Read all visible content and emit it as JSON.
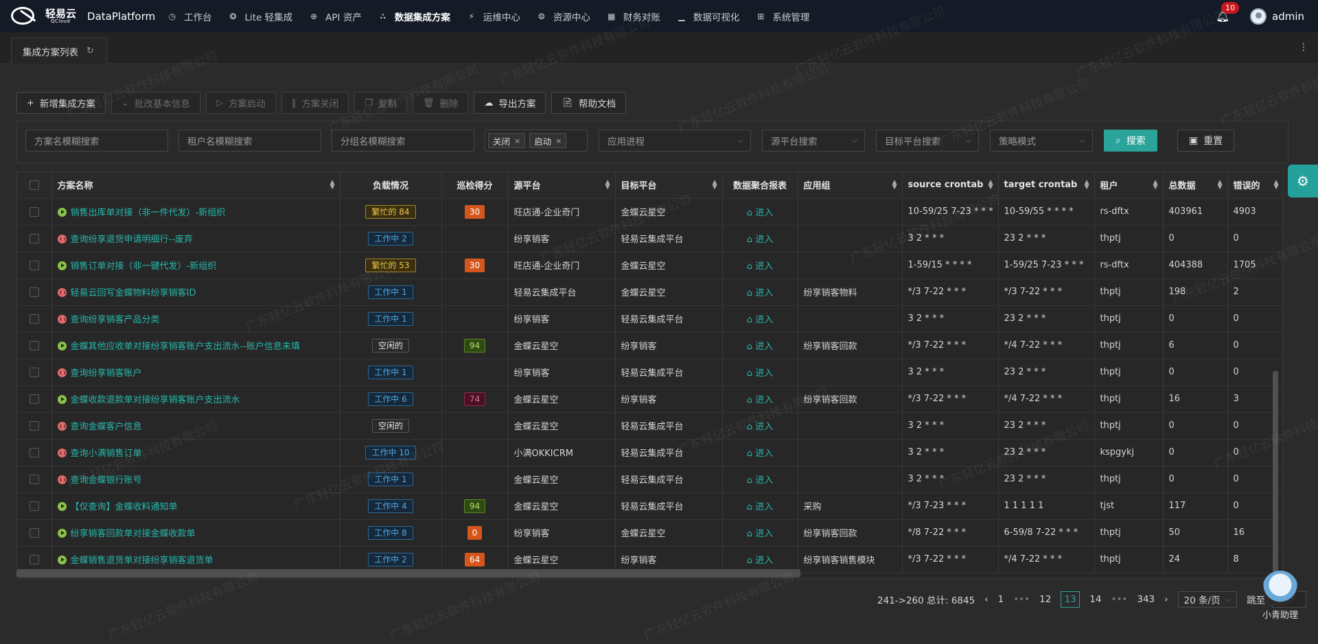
{
  "app": {
    "brand_cn": "轻易云",
    "brand_en": "QCloud",
    "title": "DataPlatform"
  },
  "nav": [
    {
      "label": "工作台",
      "icon": "clock-icon",
      "active": false
    },
    {
      "label": "Lite 轻集成",
      "icon": "bulb-icon",
      "active": false
    },
    {
      "label": "API 资产",
      "icon": "compass-icon",
      "active": false
    },
    {
      "label": "数据集成方案",
      "icon": "cluster-icon",
      "active": true
    },
    {
      "label": "运维中心",
      "icon": "bolt-icon",
      "active": false
    },
    {
      "label": "资源中心",
      "icon": "network-icon",
      "active": false
    },
    {
      "label": "财务对账",
      "icon": "calculator-icon",
      "active": false
    },
    {
      "label": "数据可视化",
      "icon": "chart-icon",
      "active": false
    },
    {
      "label": "系统管理",
      "icon": "apps-icon",
      "active": false
    }
  ],
  "notifications": {
    "count": "10"
  },
  "user": {
    "name": "admin"
  },
  "tab": {
    "label": "集成方案列表"
  },
  "toolbar": {
    "add": "新增集成方案",
    "batch_edit": "批改基本信息",
    "start": "方案启动",
    "close": "方案关闭",
    "copy": "复制",
    "delete": "删除",
    "export": "导出方案",
    "help": "帮助文档"
  },
  "filters": {
    "name_placeholder": "方案名模糊搜索",
    "tenant_placeholder": "租户名模糊搜索",
    "group_placeholder": "分组名模糊搜索",
    "status_chips": [
      "关闭",
      "启动"
    ],
    "process_placeholder": "应用进程",
    "source_placeholder": "源平台搜索",
    "target_placeholder": "目标平台搜索",
    "strategy_placeholder": "策略模式",
    "search": "搜索",
    "reset": "重置"
  },
  "table": {
    "columns": [
      "方案名称",
      "负载情况",
      "巡检得分",
      "源平台",
      "目标平台",
      "数据聚合报表",
      "应用组",
      "source crontab",
      "target crontab",
      "租户",
      "总数据",
      "错误的"
    ],
    "enter_label": "进入",
    "rows": [
      {
        "status": "run",
        "name": "销售出库单对接（非一件代发）-新组织",
        "load_type": "busy",
        "load": "繁忙的 84",
        "score": "30",
        "score_type": "orange",
        "source": "旺店通-企业奇门",
        "target": "金蝶云星空",
        "group": "",
        "src_cron": "10-59/25 7-23 * * *",
        "tgt_cron": "10-59/55 * * * *",
        "tenant": "rs-dftx",
        "total": "403961",
        "errors": "4903"
      },
      {
        "status": "pause",
        "name": "查询纷享退货申请明细行--废弃",
        "load_type": "working",
        "load": "工作中 2",
        "score": "",
        "score_type": "",
        "source": "纷享销客",
        "target": "轻易云集成平台",
        "group": "",
        "src_cron": "3 2 * * *",
        "tgt_cron": "23 2 * * *",
        "tenant": "thptj",
        "total": "0",
        "errors": "0"
      },
      {
        "status": "run",
        "name": "销售订单对接（非一键代发）-新组织",
        "load_type": "busy",
        "load": "繁忙的 53",
        "score": "30",
        "score_type": "orange",
        "source": "旺店通-企业奇门",
        "target": "金蝶云星空",
        "group": "",
        "src_cron": "1-59/15 * * * *",
        "tgt_cron": "1-59/25 7-23 * * *",
        "tenant": "rs-dftx",
        "total": "404388",
        "errors": "1705"
      },
      {
        "status": "pause",
        "name": "轻易云回写金蝶物料纷享销客ID",
        "load_type": "working",
        "load": "工作中 1",
        "score": "",
        "score_type": "",
        "source": "轻易云集成平台",
        "target": "金蝶云星空",
        "group": "纷享销客物料",
        "src_cron": "*/3 7-22 * * *",
        "tgt_cron": "*/3 7-22 * * *",
        "tenant": "thptj",
        "total": "198",
        "errors": "2"
      },
      {
        "status": "pause",
        "name": "查询纷享销客产品分类",
        "load_type": "working",
        "load": "工作中 1",
        "score": "",
        "score_type": "",
        "source": "纷享销客",
        "target": "轻易云集成平台",
        "group": "",
        "src_cron": "3 2 * * *",
        "tgt_cron": "23 2 * * *",
        "tenant": "thptj",
        "total": "0",
        "errors": "0"
      },
      {
        "status": "run",
        "name": "金蝶其他应收单对接纷享销客账户支出流水--账户信息未填",
        "load_type": "idle",
        "load": "空闲的",
        "score": "94",
        "score_type": "green",
        "source": "金蝶云星空",
        "target": "纷享销客",
        "group": "纷享销客回款",
        "src_cron": "*/3 7-22 * * *",
        "tgt_cron": "*/4 7-22 * * *",
        "tenant": "thptj",
        "total": "6",
        "errors": "0"
      },
      {
        "status": "pause",
        "name": "查询纷享销客账户",
        "load_type": "working",
        "load": "工作中 1",
        "score": "",
        "score_type": "",
        "source": "纷享销客",
        "target": "轻易云集成平台",
        "group": "",
        "src_cron": "3 2 * * *",
        "tgt_cron": "23 2 * * *",
        "tenant": "thptj",
        "total": "0",
        "errors": "0"
      },
      {
        "status": "run",
        "name": "金蝶收款退款单对接纷享销客账户支出流水",
        "load_type": "working",
        "load": "工作中 6",
        "score": "74",
        "score_type": "red",
        "source": "金蝶云星空",
        "target": "纷享销客",
        "group": "纷享销客回款",
        "src_cron": "*/3 7-22 * * *",
        "tgt_cron": "*/4 7-22 * * *",
        "tenant": "thptj",
        "total": "16",
        "errors": "3"
      },
      {
        "status": "pause",
        "name": "查询金蝶客户信息",
        "load_type": "idle",
        "load": "空闲的",
        "score": "",
        "score_type": "",
        "source": "金蝶云星空",
        "target": "轻易云集成平台",
        "group": "",
        "src_cron": "3 2 * * *",
        "tgt_cron": "23 2 * * *",
        "tenant": "thptj",
        "total": "0",
        "errors": "0"
      },
      {
        "status": "pause",
        "name": "查询小满销售订单",
        "load_type": "working",
        "load": "工作中 10",
        "score": "",
        "score_type": "",
        "source": "小满OKKICRM",
        "target": "轻易云集成平台",
        "group": "",
        "src_cron": "3 2 * * *",
        "tgt_cron": "23 2 * * *",
        "tenant": "kspgykj",
        "total": "0",
        "errors": "0"
      },
      {
        "status": "pause",
        "name": "查询金蝶银行账号",
        "load_type": "working",
        "load": "工作中 1",
        "score": "",
        "score_type": "",
        "source": "金蝶云星空",
        "target": "轻易云集成平台",
        "group": "",
        "src_cron": "3 2 * * *",
        "tgt_cron": "23 2 * * *",
        "tenant": "thptj",
        "total": "0",
        "errors": "0"
      },
      {
        "status": "run",
        "name": "【仅查询】金蝶收料通知单",
        "load_type": "working",
        "load": "工作中 4",
        "score": "94",
        "score_type": "green",
        "source": "金蝶云星空",
        "target": "轻易云集成平台",
        "group": "采购",
        "src_cron": "*/3 7-23 * * *",
        "tgt_cron": "1 1 1 1 1",
        "tenant": "tjst",
        "total": "117",
        "errors": "0"
      },
      {
        "status": "run",
        "name": "纷享销客回款单对接金蝶收款单",
        "load_type": "working",
        "load": "工作中 8",
        "score": "0",
        "score_type": "orange",
        "source": "纷享销客",
        "target": "金蝶云星空",
        "group": "纷享销客回款",
        "src_cron": "*/8 7-22 * * *",
        "tgt_cron": "6-59/8 7-22 * * *",
        "tenant": "thptj",
        "total": "50",
        "errors": "16"
      },
      {
        "status": "run",
        "name": "金蝶销售退货单对接纷享销客退货单",
        "load_type": "working",
        "load": "工作中 2",
        "score": "64",
        "score_type": "orange",
        "source": "金蝶云星空",
        "target": "纷享销客",
        "group": "纷享销客销售模块",
        "src_cron": "*/3 7-22 * * *",
        "tgt_cron": "*/4 7-22 * * *",
        "tenant": "thptj",
        "total": "24",
        "errors": "8"
      }
    ]
  },
  "pagination": {
    "summary": "241->260 总计: 6845",
    "first": "1",
    "pages": [
      "12",
      "13",
      "14"
    ],
    "current": "13",
    "last": "343",
    "page_size": "20 条/页",
    "jump_label": "跳至"
  },
  "assistant": {
    "label": "小青助理"
  },
  "watermark": "广东轻亿云软件科技有限公司"
}
